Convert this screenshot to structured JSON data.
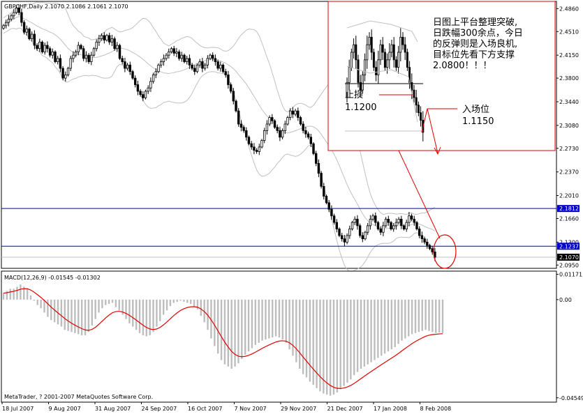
{
  "header": {
    "main_title": "GBPCHF,Daily  2.1070 2.1086 2.1061 2.1070",
    "macd_title": "MACD(12,26,9) -0.01545 -0.01302",
    "copyright": "MetaTrader, ? 2001-2007 MetaQuotes Software Corp."
  },
  "annotation": {
    "lines": [
      "日图上平台整理突破,",
      "日跌幅300余点，今日",
      "的反弹则是入场良机,",
      "目标位先看下方支撑",
      "2.0800！！！"
    ],
    "stop_label": "止损",
    "stop_value": "1.1200",
    "entry_label": "入场位",
    "entry_value": "1.1150"
  },
  "colors": {
    "background": "#ffffff",
    "candles": "#000000",
    "bands": "#c0c0c0",
    "levels": "#0000c8",
    "badge_bg": "#0000c8",
    "current_badge_bg": "#000000",
    "signal": "#e00000",
    "histogram": "#bdbdbd",
    "annotation_box": "#e00000",
    "arrows": "#e00000"
  },
  "chart_data": [
    {
      "type": "candlestick",
      "title": "GBPCHF,Daily",
      "ohlc_header": {
        "open": 2.107,
        "high": 2.1086,
        "low": 2.1061,
        "close": 2.107
      },
      "x_tick_labels": [
        "18 Jul 2007",
        "9 Aug 2007",
        "31 Aug 2007",
        "24 Sep 2007",
        "16 Oct 2007",
        "7 Nov 2007",
        "29 Nov 2007",
        "21 Dec 2007",
        "17 Jan 2008",
        "8 Feb 2008"
      ],
      "y_tick_labels": [
        "2.4860",
        "2.4510",
        "2.4150",
        "2.3800",
        "2.3440",
        "2.3080",
        "2.2730",
        "2.2370",
        "2.2010",
        "2.1660",
        "2.1300",
        "2.0950"
      ],
      "ylim": [
        2.09,
        2.497
      ],
      "price_levels": [
        {
          "value": 2.1812,
          "label": "2.1812"
        },
        {
          "value": 2.1237,
          "label": "2.1237"
        }
      ],
      "current_price": {
        "value": 2.107,
        "label": "2.1070"
      },
      "close": [
        2.46,
        2.465,
        2.47,
        2.475,
        2.48,
        2.487,
        2.48,
        2.465,
        2.45,
        2.455,
        2.44,
        2.447,
        2.43,
        2.425,
        2.435,
        2.42,
        2.43,
        2.425,
        2.415,
        2.42,
        2.405,
        2.41,
        2.395,
        2.38,
        2.385,
        2.395,
        2.41,
        2.415,
        2.42,
        2.43,
        2.425,
        2.41,
        2.415,
        2.405,
        2.415,
        2.425,
        2.435,
        2.44,
        2.445,
        2.438,
        2.445,
        2.435,
        2.44,
        2.425,
        2.43,
        2.41,
        2.405,
        2.395,
        2.4,
        2.39,
        2.38,
        2.37,
        2.36,
        2.355,
        2.35,
        2.36,
        2.365,
        2.375,
        2.385,
        2.39,
        2.4,
        2.405,
        2.41,
        2.415,
        2.42,
        2.425,
        2.418,
        2.42,
        2.41,
        2.415,
        2.405,
        2.41,
        2.4,
        2.395,
        2.39,
        2.4,
        2.405,
        2.395,
        2.4,
        2.41,
        2.415,
        2.41,
        2.405,
        2.395,
        2.4,
        2.39,
        2.385,
        2.37,
        2.36,
        2.345,
        2.33,
        2.31,
        2.305,
        2.3,
        2.29,
        2.28,
        2.275,
        2.27,
        2.268,
        2.275,
        2.285,
        2.3,
        2.31,
        2.32,
        2.315,
        2.305,
        2.3,
        2.29,
        2.3,
        2.31,
        2.32,
        2.33,
        2.325,
        2.33,
        2.32,
        2.31,
        2.3,
        2.295,
        2.29,
        2.28,
        2.265,
        2.25,
        2.235,
        2.215,
        2.2,
        2.19,
        2.18,
        2.17,
        2.16,
        2.15,
        2.14,
        2.135,
        2.13,
        2.14,
        2.15,
        2.16,
        2.165,
        2.155,
        2.14,
        2.135,
        2.145,
        2.155,
        2.165,
        2.17,
        2.16,
        2.15,
        2.145,
        2.155,
        2.165,
        2.16,
        2.15,
        2.155,
        2.16,
        2.165,
        2.155,
        2.15,
        2.16,
        2.17,
        2.165,
        2.16,
        2.15,
        2.14,
        2.135,
        2.13,
        2.125,
        2.12,
        2.115,
        2.107
      ],
      "indicators": [
        "Bollinger Bands"
      ]
    },
    {
      "type": "bar",
      "title": "MACD(12,26,9)",
      "params": [
        12,
        26,
        9
      ],
      "macd_value": -0.01545,
      "signal_value": -0.01302,
      "y_tick_labels": [
        "0.01171",
        "0.00",
        "-0.04549"
      ],
      "ylim": [
        -0.0475,
        0.0132
      ],
      "histogram": [
        0.003,
        0.004,
        0.005,
        0.005,
        0.006,
        0.007,
        0.006,
        0.005,
        0.002,
        -0.0005,
        -0.0025,
        -0.004,
        -0.006,
        -0.008,
        -0.0095,
        -0.0105,
        -0.0115,
        -0.0125,
        -0.014,
        -0.0145,
        -0.015,
        -0.0155,
        -0.016,
        -0.0165,
        -0.0165,
        -0.015,
        -0.012,
        -0.009,
        -0.006,
        -0.004,
        -0.0025,
        -0.002,
        -0.0015,
        -0.0035,
        -0.005,
        -0.007,
        -0.009,
        -0.011,
        -0.0125,
        -0.014,
        -0.0155,
        -0.0165,
        -0.017,
        -0.0165,
        -0.015,
        -0.0125,
        -0.01,
        -0.007,
        -0.005,
        -0.003,
        -0.0015,
        -0.001,
        -0.0005,
        -0.001,
        -0.0015,
        -0.002,
        -0.003,
        -0.0045,
        -0.0075,
        -0.0105,
        -0.014,
        -0.018,
        -0.0215,
        -0.025,
        -0.028,
        -0.03,
        -0.031,
        -0.032,
        -0.031,
        -0.0295,
        -0.0275,
        -0.0255,
        -0.024,
        -0.0225,
        -0.021,
        -0.02,
        -0.019,
        -0.0185,
        -0.018,
        -0.0175,
        -0.017,
        -0.0175,
        -0.0185,
        -0.02,
        -0.023,
        -0.026,
        -0.029,
        -0.032,
        -0.0345,
        -0.036,
        -0.038,
        -0.0395,
        -0.041,
        -0.0425,
        -0.0435,
        -0.044,
        -0.0445,
        -0.044,
        -0.043,
        -0.0415,
        -0.04,
        -0.0385,
        -0.037,
        -0.035,
        -0.0335,
        -0.032,
        -0.031,
        -0.03,
        -0.029,
        -0.028,
        -0.027,
        -0.026,
        -0.025,
        -0.024,
        -0.023,
        -0.022,
        -0.0205,
        -0.019,
        -0.018,
        -0.017,
        -0.016,
        -0.0155,
        -0.015,
        -0.0145,
        -0.014,
        -0.0145,
        -0.015,
        -0.0155,
        -0.0152,
        -0.0155
      ]
    }
  ]
}
